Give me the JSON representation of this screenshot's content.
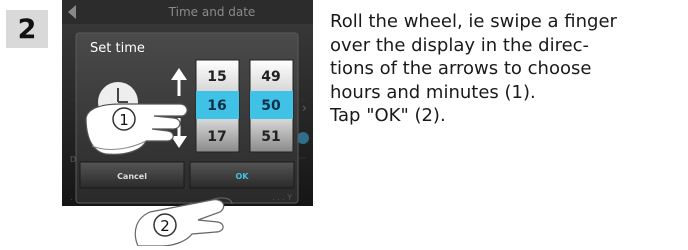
{
  "step": {
    "number": "2"
  },
  "instructions": {
    "lines": [
      "Roll the wheel, ie swipe a finger",
      "over the display in the direc-",
      "tions of the arrows to choose",
      "hours and minutes (1).",
      "Tap \"OK\" (2)."
    ]
  },
  "device": {
    "header_title": "Time and date",
    "dialog_title": "Set time",
    "hours": [
      "15",
      "16",
      "17"
    ],
    "minutes": [
      "49",
      "50",
      "51"
    ],
    "cancel_label": "Cancel",
    "ok_label": "OK",
    "callout_1": "1",
    "callout_2": "2",
    "selection_color": "#3fc2e6"
  }
}
